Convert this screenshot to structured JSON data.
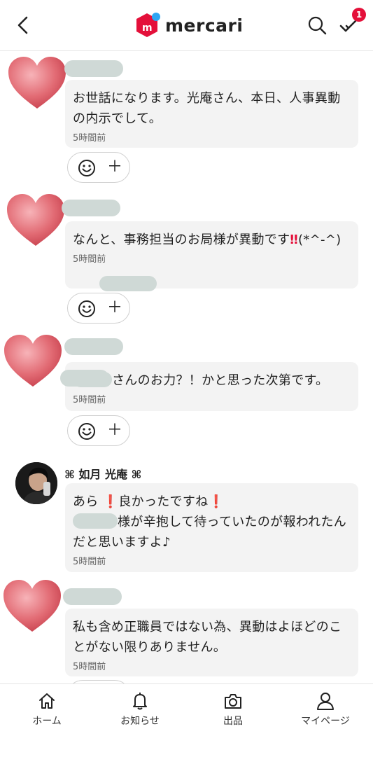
{
  "header": {
    "logo_text": "mercari",
    "logo_mark": "m",
    "badge_count": "1",
    "brand_color": "#e4103a"
  },
  "comments": [
    {
      "text": "お世話になります。光庵さん、本日、人事異動の内示でして。",
      "time": "5時間前"
    },
    {
      "text_before": "なんと、事務担当のお局様が異動です",
      "text_after": "(*^-^)",
      "time": "5時間前"
    },
    {
      "text": "さんのお力？！かと思った次第です。",
      "time": "5時間前"
    },
    {
      "user": "⌘ 如月 光庵 ⌘",
      "text_1": "あら",
      "text_2": "良かったですね",
      "text_3": "様が辛抱して待っていたのが報われたんだと思いますよ♪",
      "time": "5時間前"
    },
    {
      "text": "私も含め正職員ではない為、異動はよほどのことがない限りありません。",
      "time": "5時間前"
    }
  ],
  "tabs": [
    {
      "label": "ホーム",
      "icon": "home-icon"
    },
    {
      "label": "お知らせ",
      "icon": "bell-icon"
    },
    {
      "label": "出品",
      "icon": "camera-icon"
    },
    {
      "label": "マイページ",
      "icon": "person-icon"
    }
  ]
}
